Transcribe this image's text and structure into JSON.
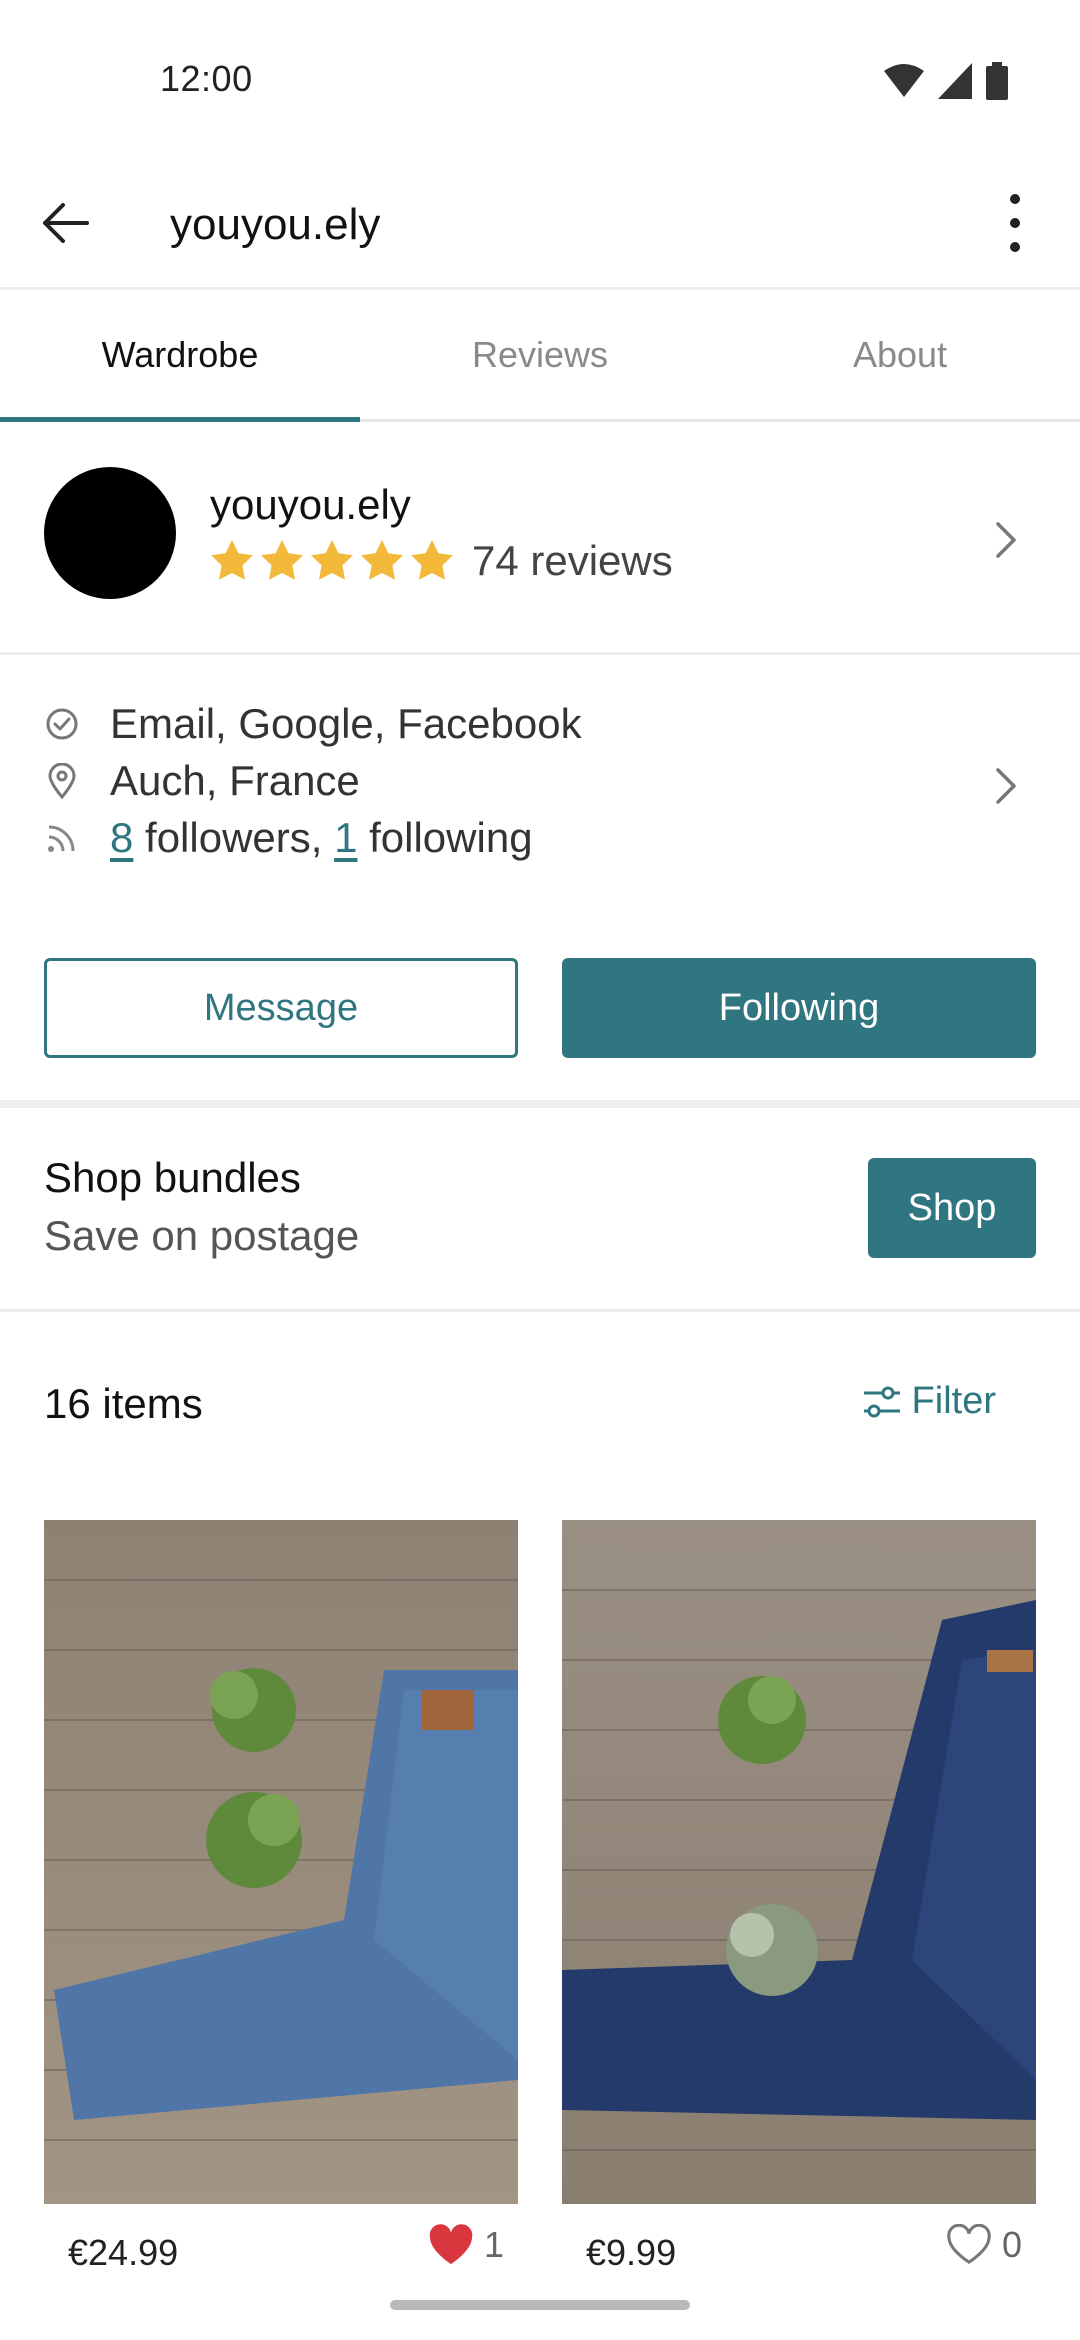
{
  "status_bar": {
    "time": "12:00"
  },
  "app_bar": {
    "title": "youyou.ely"
  },
  "tabs": [
    {
      "label": "Wardrobe",
      "active": true
    },
    {
      "label": "Reviews",
      "active": false
    },
    {
      "label": "About",
      "active": false
    }
  ],
  "profile": {
    "username": "youyou.ely",
    "rating_stars": 5,
    "reviews_text": "74 reviews"
  },
  "details": {
    "verified": "Email, Google, Facebook",
    "location": "Auch, France",
    "followers_count": "8",
    "followers_text": " followers, ",
    "following_count": "1",
    "following_text": " following"
  },
  "actions": {
    "message_label": "Message",
    "following_label": "Following"
  },
  "bundles": {
    "title": "Shop bundles",
    "subtitle": "Save on postage",
    "shop_label": "Shop"
  },
  "items": {
    "count_text": "16 items",
    "filter_label": "Filter",
    "list": [
      {
        "price": "€24.99",
        "likes": "1",
        "liked": true
      },
      {
        "price": "€9.99",
        "likes": "0",
        "liked": false
      }
    ]
  },
  "colors": {
    "accent": "#2f7681",
    "star": "#f2b93b",
    "heart": "#d9363e"
  }
}
